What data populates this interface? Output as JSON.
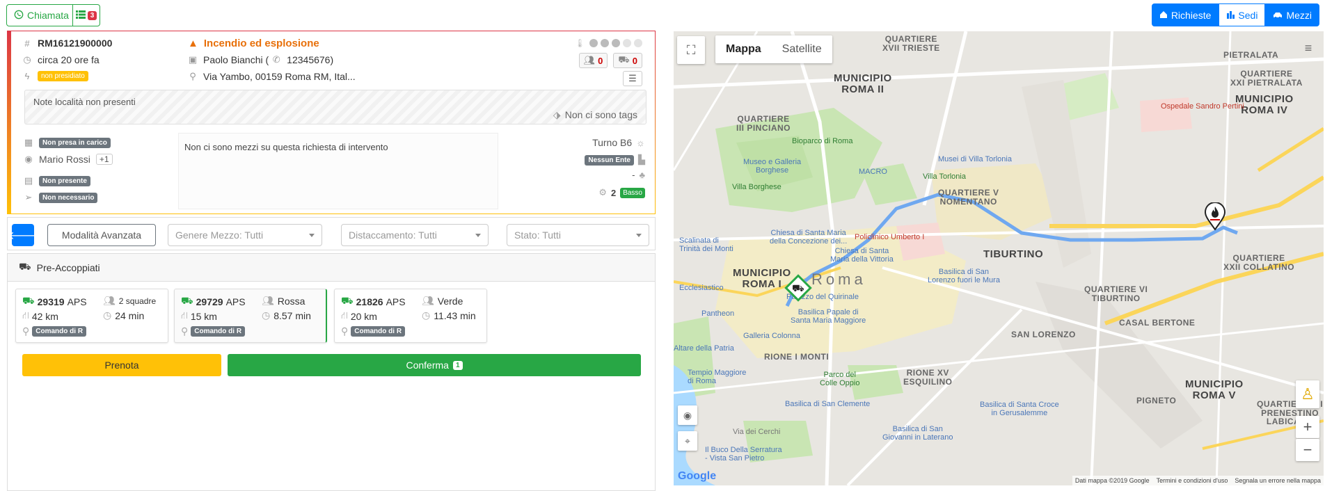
{
  "topbar": {
    "chiamata_label": "Chiamata",
    "list_badge": "3",
    "nav": [
      {
        "label": "Richieste",
        "active": false
      },
      {
        "label": "Sedi",
        "active": true
      },
      {
        "label": "Mezzi",
        "active": false
      }
    ]
  },
  "request": {
    "code": "RM16121900000",
    "time": "circa 20 ore fa",
    "priority_tag": "non presidiato",
    "title": "Incendio ed esplosione",
    "caller": "Paolo Bianchi (",
    "phone": "12345676)",
    "address": "Via Yambo, 00159 Roma RM, Ital...",
    "counters": [
      "0",
      "0"
    ],
    "notes": "Note località non presenti",
    "tags": "Non ci sono tags",
    "status_presa": "Non presa in carico",
    "operator": "Mario Rossi",
    "operator_more": "+1",
    "status_presente": "Non presente",
    "status_necessario": "Non necessario",
    "no_vehicles": "Non ci sono mezzi su questa richiesta di intervento",
    "turno": "Turno B6",
    "ente": "Nessun Ente",
    "dash": "-",
    "people_count": "2",
    "level": "Basso"
  },
  "filters": {
    "advanced": "Modalità Avanzata",
    "genere": "Genere Mezzo: Tutti",
    "distaccamento": "Distaccamento: Tutti",
    "stato": "Stato: Tutti"
  },
  "vehicles": {
    "header": "Pre-Accoppiati",
    "items": [
      {
        "id": "29319",
        "type": "APS",
        "crew": "2 squadre",
        "km": "42 km",
        "time": "24 min",
        "sede": "Comando di R"
      },
      {
        "id": "29729",
        "type": "APS",
        "crew": "Rossa",
        "km": "15 km",
        "time": "8.57 min",
        "sede": "Comando di R"
      },
      {
        "id": "21826",
        "type": "APS",
        "crew": "Verde",
        "km": "20 km",
        "time": "11.43 min",
        "sede": "Comando di R"
      }
    ],
    "prenota": "Prenota",
    "conferma": "Conferma",
    "conferma_count": "1"
  },
  "map": {
    "type_map": "Mappa",
    "type_satellite": "Satellite",
    "labels": {
      "m2": "MUNICIPIO\nROMA II",
      "m1": "MUNICIPIO\nROMA I",
      "m4": "MUNICIPIO\nROMA IV",
      "m5": "MUNICIPIO\nROMA V",
      "q17": "QUARTIERE\nXVII TRIESTE",
      "q3": "QUARTIERE\nIII PINCIANO",
      "q5": "QUARTIERE V\nNOMENTANO",
      "q21": "QUARTIERE\nXXI PIETRALATA",
      "q22": "QUARTIERE\nXXII COLLATINO",
      "tiburtino": "TIBURTINO",
      "qtib": "QUARTIERE VI\nTIBURTINO",
      "casal": "CASAL BERTONE",
      "sanlor": "SAN LORENZO",
      "rione1": "RIONE I MONTI",
      "rione15": "RIONE XV\nESQUILINO",
      "pigneto": "PIGNETO",
      "q7": "QUARTIERE VII\nPRENESTINO\nLABICANO",
      "pietralata": "PIETRALATA",
      "roma": "Roma"
    },
    "pois": {
      "bioparco": "Bioparco di Roma",
      "borghese": "Museo e Galleria\nBorghese",
      "villaborghese": "Villa Borghese",
      "macro": "MACRO",
      "torlonia": "Villa Torlonia",
      "museotorlonia": "Musei di Villa Torlonia",
      "pertini": "Ospedale Sandro Pertini",
      "policlinico": "Policlinico Umberto I",
      "vittoria": "Chiesa di Santa\nMaria della Vittoria",
      "concezione": "Chiesa di Santa Maria\ndella Concezione dei...",
      "scalinata": "Scalinata di\nTrinità dei Monti",
      "pantheon": "Pantheon",
      "colonna": "Galleria Colonna",
      "quirinale": "Palazzo del Quirinale",
      "maggiore": "Basilica Papale di\nSanta Maria Maggiore",
      "sanlorenzo": "Basilica di San\nLorenzo fuori le Mura",
      "patria": "Altare della Patria",
      "tempio": "Tempio Maggiore\ndi Roma",
      "oppio": "Parco del\nColle Oppio",
      "clemente": "Basilica di San Clemente",
      "croce": "Basilica di Santa Croce\nin Gerusalemme",
      "laterano": "Basilica di San\nGiovanni in Laterano",
      "ecclesiastico": "Ecclesiastico",
      "cerchi": "Via dei Cerchi",
      "serratura": "Il Buco Della Serratura\n- Vista San Pietro"
    },
    "attribution": [
      "Dati mappa ©2019 Google",
      "Termini e condizioni d'uso",
      "Segnala un errore nella mappa"
    ],
    "google": "Google"
  }
}
